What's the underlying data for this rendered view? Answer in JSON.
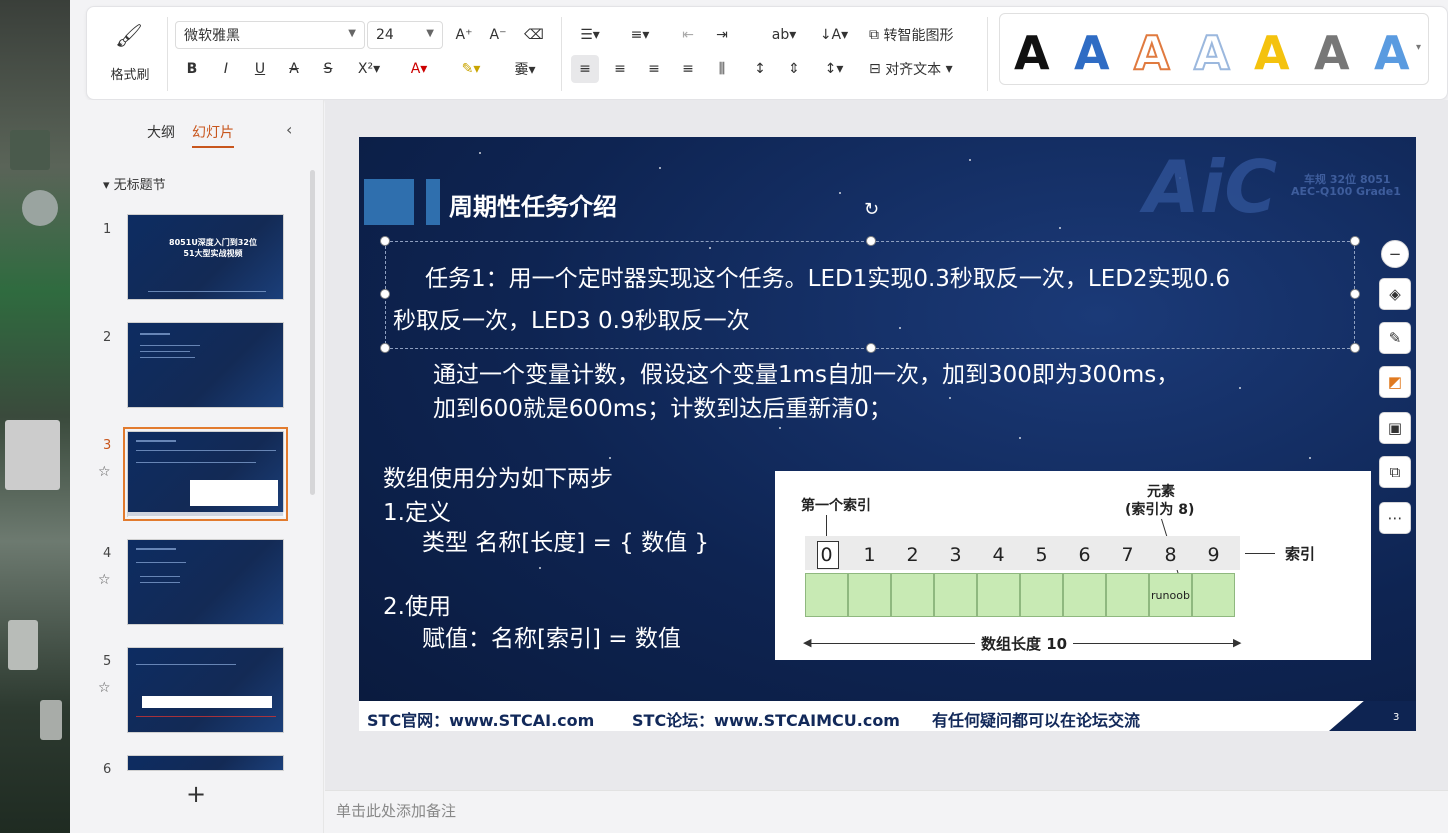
{
  "ribbon": {
    "format_painter": "格式刷",
    "font_name": "微软雅黑",
    "font_size": "24",
    "smart_art": "转智能图形",
    "align_text": "对齐文本"
  },
  "panel": {
    "tab_outline": "大纲",
    "tab_slides": "幻灯片",
    "section_title": "无标题节",
    "slide_numbers": [
      "1",
      "2",
      "3",
      "4",
      "5",
      "6"
    ],
    "thumb1_title": "8051U深度入门到32位51大型实战视频",
    "add_label": "+"
  },
  "slide": {
    "title": "周期性任务介绍",
    "watermark": "AiC",
    "watermark_sub1": "车规 32位 8051",
    "watermark_sub2": "AEC-Q100 Grade1",
    "task_line1": "任务1：用一个定时器实现这个任务。LED1实现0.3秒取反一次，LED2实现0.6",
    "task_line2": "秒取反一次，LED3 0.9秒取反一次",
    "counter_line1": "通过一个变量计数，假设这个变量1ms自加一次，加到300即为300ms，",
    "counter_line2": "加到600就是600ms；计数到达后重新清0；",
    "array_intro": "数组使用分为如下两步",
    "def_title": "1.定义",
    "def_body": "类型 名称[长度] = { 数值 }",
    "use_title": "2.使用",
    "use_body": "赋值：名称[索引] = 数值",
    "diagram": {
      "first_index": "第一个索引",
      "element": "元素",
      "element_sub": "(索引为 8)",
      "index_label": "索引",
      "indices": [
        "0",
        "1",
        "2",
        "3",
        "4",
        "5",
        "6",
        "7",
        "8",
        "9"
      ],
      "cell_value": "runoob",
      "length_label": "数组长度 10"
    },
    "footer_site": "STC官网：www.STCAI.com",
    "footer_forum": "STC论坛：www.STCAIMCU.com",
    "footer_note": "有任何疑问都可以在论坛交流",
    "page_num": "3"
  },
  "notes_placeholder": "单击此处添加备注",
  "side_tools": [
    "minus-icon",
    "layers-icon",
    "brush-icon",
    "fill-icon",
    "frame-icon",
    "slide-tool-icon",
    "more-icon"
  ]
}
